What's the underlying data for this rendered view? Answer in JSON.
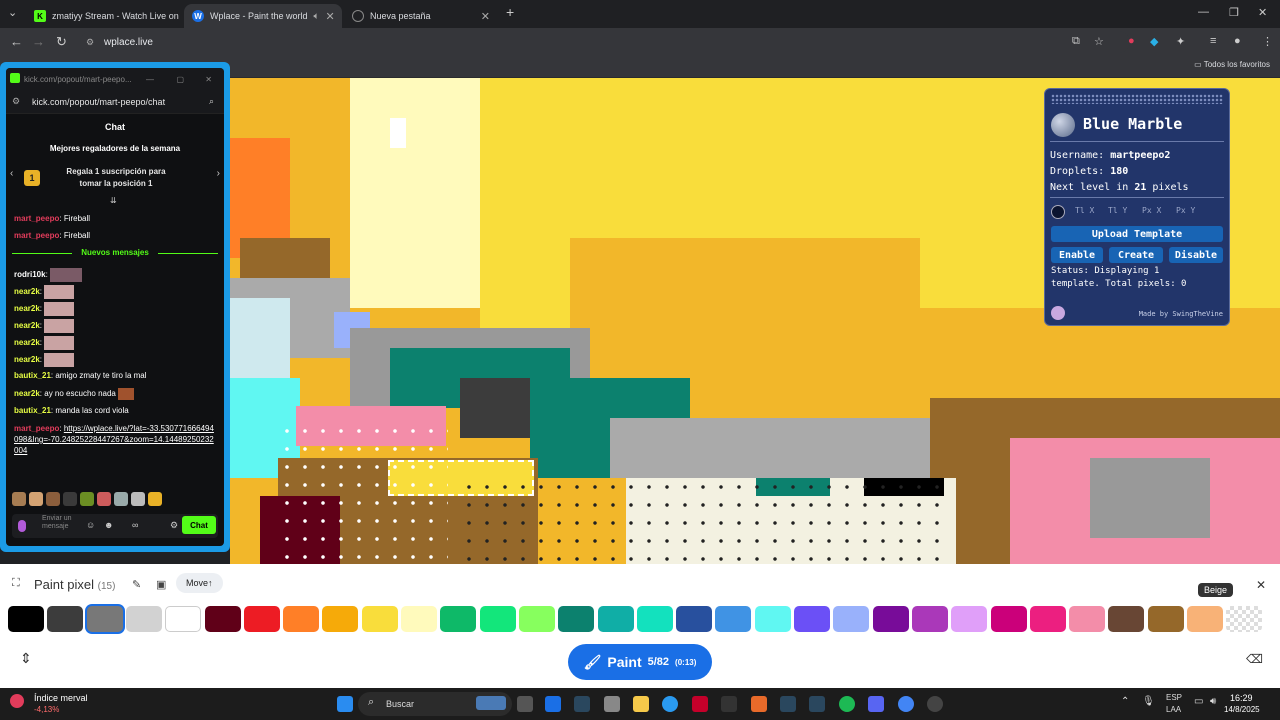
{
  "browser": {
    "tabs": [
      {
        "label": "zmatiyy Stream - Watch Live on",
        "favicon": "K",
        "favicon_color": "#53fc18"
      },
      {
        "label": "Wplace - Paint the world",
        "favicon": "W",
        "favicon_color": "#1a6fe6"
      },
      {
        "label": "Nueva pestaña",
        "favicon": "globe",
        "favicon_color": "#888"
      }
    ],
    "url": "wplace.live",
    "bookmarks_label": "Todos los favoritos"
  },
  "kick": {
    "window_title": "kick.com/popout/mart-peepo...",
    "url": "kick.com/popout/mart-peepo/chat",
    "chat_heading": "Chat",
    "top_gifters": "Mejores regaladores de la semana",
    "rank": "1",
    "promo": "Regala 1 suscripción para tomar la posición 1",
    "new_messages": "Nuevos mensajes",
    "messages": [
      {
        "user": "mart_peepo",
        "text": "Fireball",
        "color": "#e23c5b"
      },
      {
        "user": "mart_peepo",
        "text": "Fireball",
        "color": "#e23c5b"
      },
      {
        "user": "rodri10k",
        "text": "",
        "color": "#fff"
      },
      {
        "user": "near2k",
        "text": "",
        "color": "#e8ff44"
      },
      {
        "user": "near2k",
        "text": "",
        "color": "#e8ff44"
      },
      {
        "user": "near2k",
        "text": "",
        "color": "#e8ff44"
      },
      {
        "user": "near2k",
        "text": "",
        "color": "#e8ff44"
      },
      {
        "user": "near2k",
        "text": "",
        "color": "#e8ff44"
      },
      {
        "user": "bautix_21",
        "text": "amigo zmaty te tiro la mal",
        "color": "#e8ff44"
      },
      {
        "user": "near2k",
        "text": "ay no escucho nada",
        "color": "#e8ff44"
      },
      {
        "user": "bautix_21",
        "text": "manda las cord viola",
        "color": "#e8ff44"
      },
      {
        "user": "mart_peepo",
        "text": "https://wplace.live/?lat=-33.530771666494098&lng=-70.24825228447267&zoom=14.14489250232004",
        "color": "#e23c5b"
      }
    ],
    "input_placeholder": "Enviar un mensaje",
    "send_label": "Chat"
  },
  "blue_marble": {
    "title": "Blue Marble",
    "username_label": "Username:",
    "username": "martpeepo2",
    "droplets_label": "Droplets:",
    "droplets": "180",
    "next_level_prefix": "Next level in",
    "next_level_value": "21",
    "next_level_suffix": "pixels",
    "coords": [
      "Tl X",
      "Tl Y",
      "Px X",
      "Px Y"
    ],
    "upload": "Upload Template",
    "enable": "Enable",
    "create": "Create",
    "disable": "Disable",
    "status": "Status: Displaying 1 template. Total pixels: 0",
    "made_by": "Made by SwingTheVine"
  },
  "paint": {
    "title": "Paint pixel",
    "count": "(15)",
    "move": "Move",
    "tooltip": "Beige",
    "button": "Paint",
    "progress": "5/82",
    "timer": "(0:13)",
    "palette": [
      "#000000",
      "#3c3c3c",
      "#787878",
      "#d2d2d2",
      "#ffffff",
      "#600018",
      "#ed1c24",
      "#ff7f27",
      "#f6aa09",
      "#f9dd3b",
      "#fffabc",
      "#0eb968",
      "#13e67b",
      "#87ff5e",
      "#0c816e",
      "#10aea6",
      "#13e1be",
      "#28509e",
      "#4093e4",
      "#60f7f2",
      "#6b50f6",
      "#99b1fb",
      "#780c99",
      "#aa38b9",
      "#e09ff9",
      "#cb007a",
      "#ec1f80",
      "#f38da9",
      "#684634",
      "#95682a",
      "#f8b277",
      "transparent"
    ]
  },
  "taskbar": {
    "weather_title": "Índice merval",
    "weather_value": "-4,13%",
    "search": "Buscar",
    "lang1": "ESP",
    "lang2": "LAA",
    "time": "16:29",
    "date": "14/8/2025"
  }
}
